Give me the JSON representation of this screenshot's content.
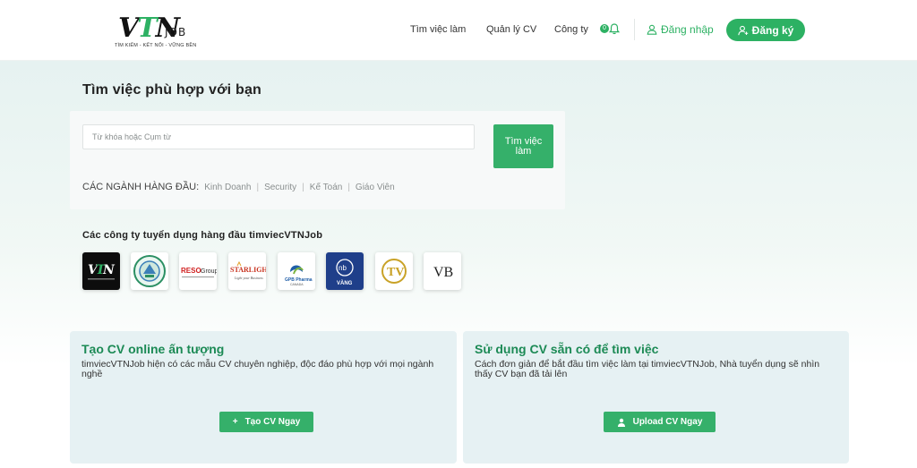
{
  "header": {
    "logo_mark_a": "V",
    "logo_mark_b": "T",
    "logo_mark_c": "N",
    "logo_job": "JOB",
    "logo_tagline": "TÌM KIẾM - KẾT NỐI - VỮNG BỀN",
    "nav": {
      "jobs": "Tìm việc làm",
      "cv_manage": "Quản lý CV",
      "company": "Công ty"
    },
    "notification_count": "0",
    "login_label": "Đăng nhập",
    "register_label": "Đăng ký"
  },
  "hero": {
    "title": "Tìm việc phù hợp với bạn",
    "search_placeholder": "Từ khóa hoặc Cụm từ",
    "search_button": "Tìm việc làm",
    "top_industries_label": "CÁC NGÀNH HÀNG ĐẦU:",
    "industries": [
      "Kinh Doanh",
      "Security",
      "Kế Toán",
      "Giáo Viên"
    ]
  },
  "companies": {
    "title": "Các công ty tuyển dụng hàng đầu timviecVTNJob",
    "logos": [
      {
        "name": "vtnjob-logo",
        "text": "VTN",
        "style": "dark"
      },
      {
        "name": "school-emblem-logo",
        "text": "",
        "style": "emblem"
      },
      {
        "name": "reso-group-logo",
        "text": "RESO Group",
        "style": "reso"
      },
      {
        "name": "starlight-logo",
        "text": "STARLIGHT",
        "style": "starlight"
      },
      {
        "name": "gpb-pharma-logo",
        "text": "GPB Pharma",
        "style": "gpb"
      },
      {
        "name": "nhuom-ban-vang-logo",
        "text": "VÀNG",
        "style": "navy"
      },
      {
        "name": "tv-gold-logo",
        "text": "TV",
        "style": "gold"
      },
      {
        "name": "vb-logo",
        "text": "VB",
        "style": "vb"
      }
    ]
  },
  "cards": {
    "create": {
      "title": "Tạo CV online ấn tượng",
      "desc": "timviecVTNJob hiện có các mẫu CV chuyên nghiệp, độc đáo phù hợp với mọi ngành nghề",
      "button": "Tạo CV Ngay",
      "button_icon": "plus-icon"
    },
    "upload": {
      "title": "Sử dụng CV sẵn có để tìm việc",
      "desc": "Cách đơn giản để bắt đầu tìm việc làm tại timviecVTNJob, Nhà tuyển dụng sẽ nhìn thấy CV bạn đã tải lên",
      "button": "Upload CV Ngay",
      "button_icon": "upload-icon"
    }
  },
  "colors": {
    "brand_green": "#2db163",
    "title_green": "#1c8a55",
    "card_bg": "#e6f1f3"
  }
}
